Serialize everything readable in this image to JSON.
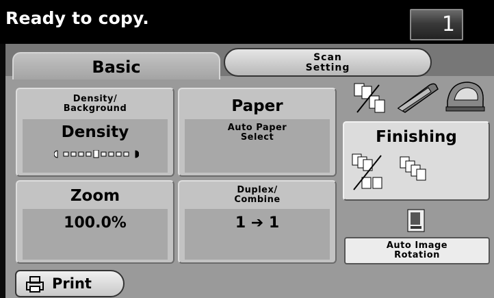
{
  "status": {
    "message": "Ready to copy.",
    "copy_count": "1"
  },
  "tabs": {
    "basic": "Basic",
    "scan_setting": "Scan\nSetting"
  },
  "density": {
    "title": "Density/\nBackground",
    "value": "Density",
    "level": 0.5,
    "steps": 9
  },
  "paper": {
    "title": "Paper",
    "value": "Auto Paper\nSelect"
  },
  "zoom": {
    "title": "Zoom",
    "value": "100.0%"
  },
  "duplex": {
    "title": "Duplex/\nCombine",
    "value": "1 ➔ 1"
  },
  "finishing": {
    "title": "Finishing"
  },
  "auto_rotation": {
    "label": "Auto Image\nRotation"
  },
  "print": {
    "label": "Print"
  },
  "colors": {
    "background": "#000000",
    "panel": "#777777",
    "button": "#c3c3c3",
    "text": "#000000"
  }
}
